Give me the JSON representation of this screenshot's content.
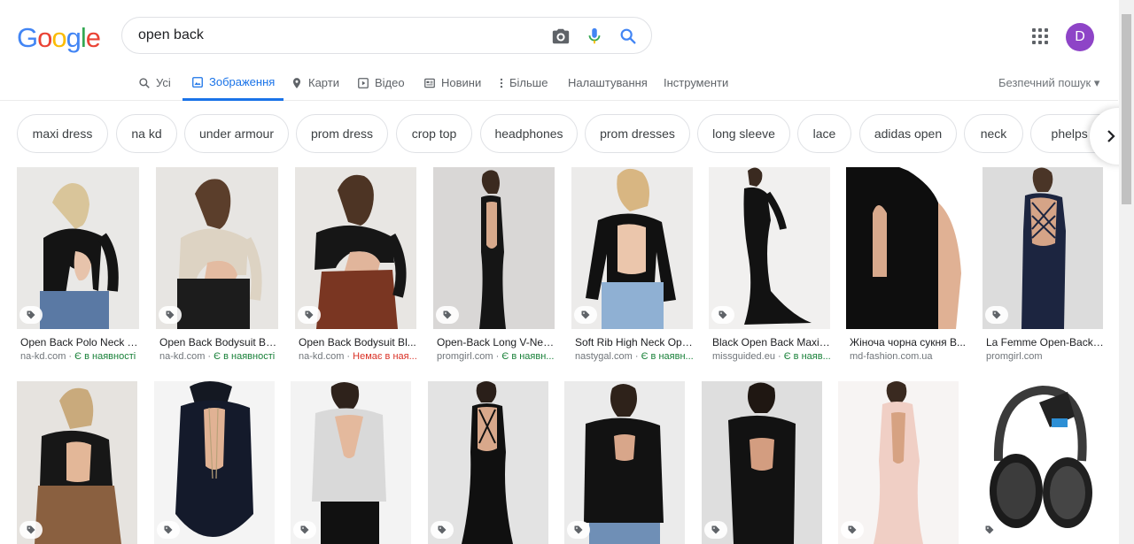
{
  "logo": {
    "letters": [
      "G",
      "o",
      "o",
      "g",
      "l",
      "e"
    ],
    "colors": [
      "#4285f4",
      "#ea4335",
      "#fbbc05",
      "#4285f4",
      "#34a853",
      "#ea4335"
    ]
  },
  "search": {
    "query": "open back",
    "icons": [
      "camera-icon",
      "microphone-icon",
      "search-icon"
    ]
  },
  "account": {
    "initial": "D",
    "color": "#8e44c7"
  },
  "tabs": [
    {
      "label": "Усі",
      "icon": "search-icon"
    },
    {
      "label": "Зображення",
      "icon": "image-icon",
      "active": true
    },
    {
      "label": "Карти",
      "icon": "pin-icon"
    },
    {
      "label": "Відео",
      "icon": "play-icon"
    },
    {
      "label": "Новини",
      "icon": "news-icon"
    },
    {
      "label": "Більше",
      "icon": "more-vert-icon"
    },
    {
      "label": "Налаштування"
    },
    {
      "label": "Інструменти"
    }
  ],
  "safe_search": "Безпечний пошук ▾",
  "chips": [
    "maxi dress",
    "na kd",
    "under armour",
    "prom dress",
    "crop top",
    "headphones",
    "prom dresses",
    "long sleeve",
    "lace",
    "adidas open",
    "neck",
    "phelps n"
  ],
  "results_row1": [
    {
      "title": "Open Back Polo Neck T...",
      "source": "na-kd.com",
      "status": "Є в наявності",
      "in_stock": true
    },
    {
      "title": "Open Back Bodysuit Bei...",
      "source": "na-kd.com",
      "status": "Є в наявності",
      "in_stock": true
    },
    {
      "title": "Open Back Bodysuit Bl...",
      "source": "na-kd.com",
      "status": "Немає в ная...",
      "in_stock": false
    },
    {
      "title": "Open-Back Long V-Nec...",
      "source": "promgirl.com",
      "status": "Є в наявн...",
      "in_stock": true
    },
    {
      "title": "Soft Rib High Neck Ope...",
      "source": "nastygal.com",
      "status": "Є в наявн...",
      "in_stock": true
    },
    {
      "title": "Black Open Back Maxi ...",
      "source": "missguided.eu",
      "status": "Є в наяв...",
      "in_stock": true
    },
    {
      "title": "Жіноча чорна сукня В...",
      "source": "md-fashion.com.ua",
      "status": "",
      "in_stock": null
    },
    {
      "title": "La Femme Open-Back ...",
      "source": "promgirl.com",
      "status": "",
      "in_stock": null
    }
  ],
  "colors": {
    "accent": "#1a73e8",
    "in_stock": "#188038",
    "out_of_stock": "#d93025"
  }
}
